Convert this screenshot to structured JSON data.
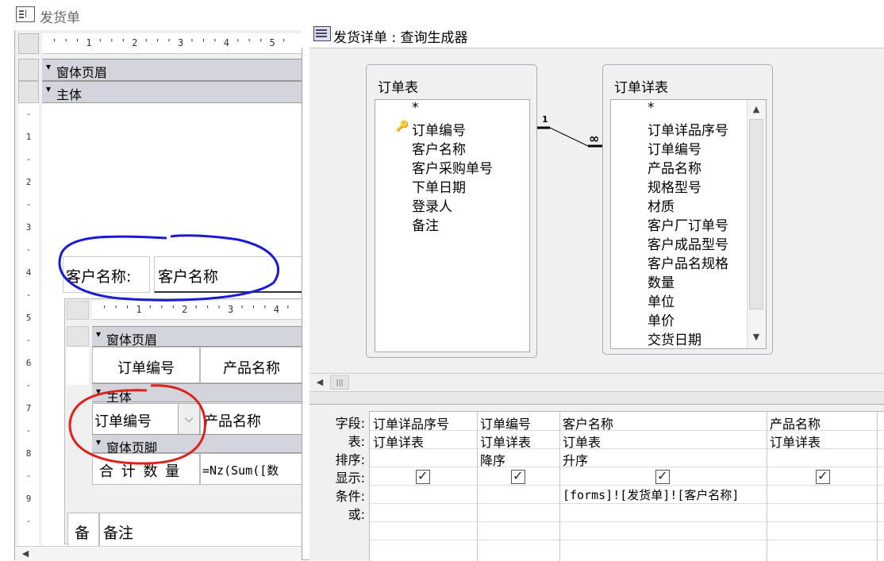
{
  "form_window": {
    "title": "发货单",
    "ruler_top": "' ' ' 1 ' ' ' 2 ' ' ' 3 ' ' ' 4 ' ' ' 5 '",
    "sections": {
      "header": "窗体页眉",
      "detail": "主体"
    },
    "ruler_left": [
      "-",
      "1",
      "-",
      "2",
      "-",
      "3",
      "-",
      "4",
      "-",
      "5",
      "-",
      "6",
      "-",
      "7",
      "-",
      "8",
      "-",
      "9",
      "-"
    ],
    "customer_label": "客户名称:",
    "customer_textbox": "客户名称",
    "subform": {
      "ruler_top": "' ' ' 1 ' ' ' 2 ' ' ' 3 ' ' ' 4 '",
      "header_section": "窗体页眉",
      "col_headers": [
        "订单编号",
        "产品名称"
      ],
      "detail_section": "主体",
      "order_combo": "订单编号",
      "product_field": "产品名称",
      "footer_section": "窗体页脚",
      "total_label": "合 计 数 量",
      "total_expr": "=Nz(Sum([数"
    },
    "remark_label": "备",
    "remark_field": "备注"
  },
  "query_builder": {
    "title": "发货详单 : 查询生成器",
    "tables": [
      {
        "name": "订单表",
        "key_icon": "key-icon",
        "fields": [
          "*",
          "订单编号",
          "客户名称",
          "客户采购单号",
          "下单日期",
          "登录人",
          "备注"
        ]
      },
      {
        "name": "订单详表",
        "fields": [
          "*",
          "订单详品序号",
          "订单编号",
          "产品名称",
          "规格型号",
          "材质",
          "客户厂订单号",
          "客户成品型号",
          "客户品名规格",
          "数量",
          "单位",
          "单价",
          "交货日期"
        ]
      }
    ],
    "relation": {
      "one": "1",
      "many": "∞"
    },
    "grid": {
      "row_labels": [
        "字段:",
        "表:",
        "排序:",
        "显示:",
        "条件:",
        "或:"
      ],
      "columns": [
        {
          "field": "订单详品序号",
          "table": "订单详表",
          "sort": "",
          "show": true,
          "criteria": ""
        },
        {
          "field": "订单编号",
          "table": "订单详表",
          "sort": "降序",
          "show": true,
          "criteria": ""
        },
        {
          "field": "客户名称",
          "table": "订单表",
          "sort": "升序",
          "show": true,
          "criteria": "[forms]![发货单]![客户名称]"
        },
        {
          "field": "产品名称",
          "table": "订单详表",
          "sort": "",
          "show": true,
          "criteria": ""
        }
      ]
    }
  },
  "annotations": {
    "blue_circle_color": "#1a1ad6",
    "red_circle_color": "#e0201a"
  }
}
